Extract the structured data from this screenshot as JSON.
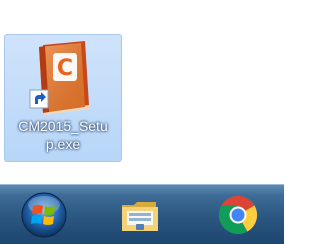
{
  "desktop": {
    "shortcut": {
      "label_line1": "CM2015_Setu",
      "label_line2": "p.exe",
      "icon": "cm-installer-icon",
      "icon_letter": "C",
      "overlay_icon": "shortcut-arrow-icon"
    }
  },
  "taskbar": {
    "start": {
      "icon": "windows-start-orb-icon"
    },
    "pinned": [
      {
        "name": "windows-explorer",
        "icon": "folder-icon"
      },
      {
        "name": "google-chrome",
        "icon": "chrome-icon"
      }
    ]
  },
  "colors": {
    "selection": "#b7d6f8",
    "app_icon_orange": "#e8641e",
    "taskbar": "#2a567f"
  }
}
